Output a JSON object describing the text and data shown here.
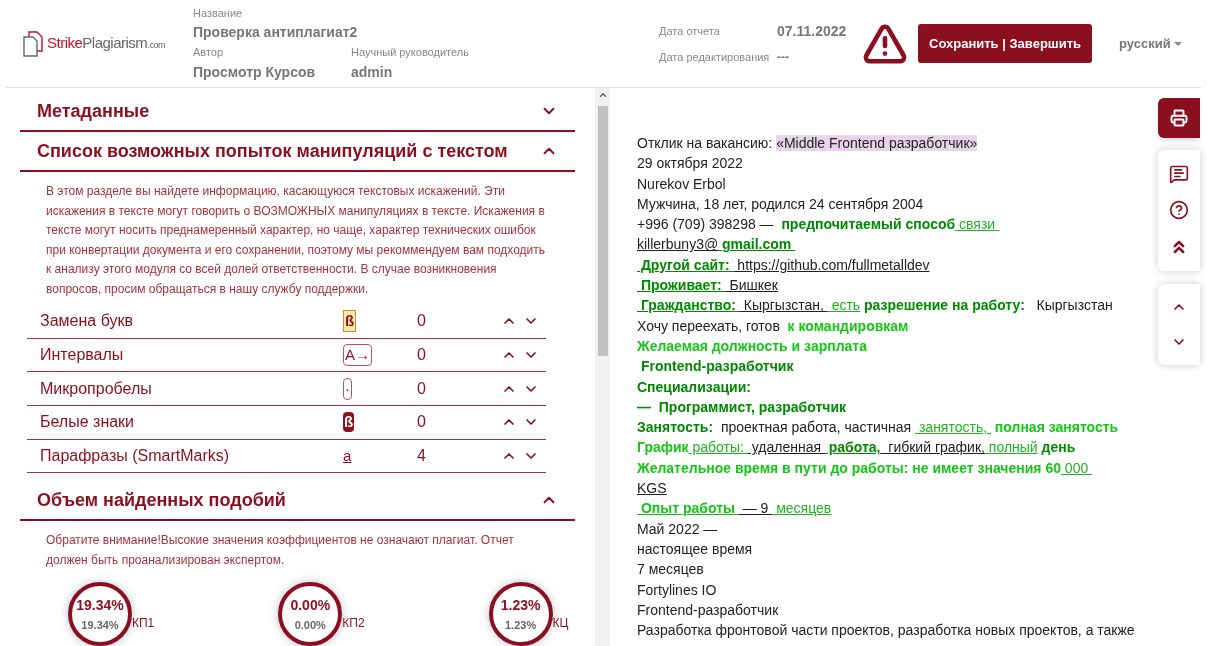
{
  "header": {
    "logo": {
      "part_1": "Strike",
      "part_2": "Plagiarism",
      "part_3": ".com"
    },
    "fields": [
      {
        "label": "Название",
        "value": "Проверка антиплагиат2"
      },
      {
        "label": "Автор",
        "value": "Просмотр Курсов"
      },
      {
        "label": "Научный руководитель",
        "value": "admin"
      }
    ],
    "dates": [
      {
        "label": "Дата отчета",
        "value": "07.11.2022"
      },
      {
        "label": "Дата редактирования",
        "value": "---"
      }
    ],
    "save_button": "Сохранить | Завершить",
    "language": "русский"
  },
  "sections": [
    {
      "title": "Метаданные",
      "expanded": false
    },
    {
      "title": "Список возможных попыток манипуляций с текстом",
      "expanded": true,
      "description": "В этом разделе вы найдете информацию, касающуюся текстовых искажений. Эти искажения в тексте могут говорить о ВОЗМОЖНЫХ манипуляциях в тексте. Искажения в тексте могут носить преднамеренный характер, но чаще, характер технических ошибок при конвертации документа и его сохранении, поэтому мы рекоммендуем вам подходить к анализу этого модуля со всей долей ответственности. В случае возникновения вопросов, просим обращаться в нашу службу поддержки.",
      "rows": [
        {
          "label": "Замена букв",
          "marker": "ß",
          "kind": "highlight",
          "count": "0"
        },
        {
          "label": "Интервалы",
          "marker": "A→",
          "kind": "boxed",
          "count": "0"
        },
        {
          "label": "Микропробелы",
          "marker": "·",
          "kind": "boxed",
          "count": "0"
        },
        {
          "label": "Белые знаки",
          "marker": "ß",
          "kind": "inverted",
          "count": "0"
        },
        {
          "label": "Парафразы (SmartMarks)",
          "marker": "a",
          "kind": "underlined",
          "count": "4"
        }
      ]
    },
    {
      "title": "Объем найденных подобий",
      "expanded": true,
      "description": "Обратите внимание!Высокие значения коэффициентов не означают плагиат. Отчет должен быть проанализирован экспертом.",
      "gauges": [
        {
          "value": "19.34%",
          "subvalue": "19.34%",
          "label": "КП1"
        },
        {
          "value": "0.00%",
          "subvalue": "0.00%",
          "label": "КП2"
        },
        {
          "value": "1.23%",
          "subvalue": "1.23%",
          "label": "КЦ"
        }
      ]
    }
  ],
  "document": {
    "lines": [
      [
        {
          "text": "Отклик на вакансию: ",
          "kind": "plain",
          "underlined": false
        },
        {
          "text": "«Middle Frontend разработчик»",
          "kind": "highlight",
          "underlined": false
        }
      ],
      [
        {
          "text": "29 октября 2022",
          "kind": "plain",
          "underlined": false
        }
      ],
      [
        {
          "text": "Nurekov Erbol",
          "kind": "plain",
          "underlined": false
        }
      ],
      [
        {
          "text": "Мужчина, 18 лет, родился 24 сентября 2004",
          "kind": "plain",
          "underlined": false
        }
      ],
      [
        {
          "text": "+996 (709) 398298 — ",
          "kind": "plain",
          "underlined": false
        },
        {
          "text": " предпочитаемый способ",
          "kind": "strong",
          "underlined": false
        },
        {
          "text": " связи ",
          "kind": "link",
          "underlined": true
        }
      ],
      [
        {
          "text": "killerbuny3@",
          "kind": "plain",
          "underlined": true
        },
        {
          "text": " gmail.com ",
          "kind": "strong",
          "underlined": true
        }
      ],
      [
        {
          "text": " Другой сайт: ",
          "kind": "strong",
          "underlined": true
        },
        {
          "text": " https://github.com/fullmetalldev",
          "kind": "plain",
          "underlined": true
        }
      ],
      [
        {
          "text": " Проживает: ",
          "kind": "strong",
          "underlined": true
        },
        {
          "text": " Бишкек",
          "kind": "plain",
          "underlined": true
        }
      ],
      [
        {
          "text": " Гражданство: ",
          "kind": "strong",
          "underlined": true
        },
        {
          "text": " Кыргызстан, ",
          "kind": "plain",
          "underlined": true
        },
        {
          "text": " есть",
          "kind": "link",
          "underlined": true
        },
        {
          "text": " разрешение на работу: ",
          "kind": "strong",
          "underlined": false
        },
        {
          "text": "  Кыргызстан",
          "kind": "plain",
          "underlined": false
        }
      ],
      [
        {
          "text": "Хочу переехать, готов ",
          "kind": "plain",
          "underlined": false
        },
        {
          "text": " к командировкам",
          "kind": "bright",
          "underlined": false
        }
      ],
      [
        {
          "text": "Желаемая должность и зарплата",
          "kind": "bright",
          "underlined": false
        }
      ],
      [
        {
          "text": " Frontend-разработчик",
          "kind": "strong",
          "underlined": false
        }
      ],
      [
        {
          "text": "Специализации:",
          "kind": "strong",
          "underlined": false
        }
      ],
      [
        {
          "text": "—  Программист, разработчик",
          "kind": "strong",
          "underlined": false
        }
      ],
      [
        {
          "text": "Занятость:",
          "kind": "strong",
          "underlined": false
        },
        {
          "text": "  проектная работа, частичная ",
          "kind": "plain",
          "underlined": false
        },
        {
          "text": " занятость, ",
          "kind": "link",
          "underlined": true
        },
        {
          "text": " полная занятость",
          "kind": "bright",
          "underlined": false
        }
      ],
      [
        {
          "text": "График",
          "kind": "bright",
          "underlined": false
        },
        {
          "text": " работы: ",
          "kind": "link",
          "underlined": true
        },
        {
          "text": " удаленная ",
          "kind": "plain",
          "underlined": true
        },
        {
          "text": " работа,",
          "kind": "strong",
          "underlined": true
        },
        {
          "text": "  гибкий график,",
          "kind": "plain",
          "underlined": true
        },
        {
          "text": " полный",
          "kind": "link",
          "underlined": true
        },
        {
          "text": " день",
          "kind": "strong",
          "underlined": false
        }
      ],
      [
        {
          "text": "Желательное время в пути до работы: не имеет значения 60",
          "kind": "bright",
          "underlined": false
        },
        {
          "text": " 000 ",
          "kind": "link",
          "underlined": true
        }
      ],
      [
        {
          "text": "KGS",
          "kind": "plain",
          "underlined": true
        }
      ],
      [
        {
          "text": " Опыт работы ",
          "kind": "bright",
          "underlined": true
        },
        {
          "text": " — 9 ",
          "kind": "plain",
          "underlined": true
        },
        {
          "text": " месяцев",
          "kind": "link",
          "underlined": true
        }
      ],
      [
        {
          "text": "Май 2022 —",
          "kind": "plain",
          "underlined": false
        }
      ],
      [
        {
          "text": "настоящее время",
          "kind": "plain",
          "underlined": false
        }
      ],
      [
        {
          "text": "7 месяцев",
          "kind": "plain",
          "underlined": false
        }
      ],
      [
        {
          "text": "Fortylines IO",
          "kind": "plain",
          "underlined": false
        }
      ],
      [
        {
          "text": "Frontend-разработчик",
          "kind": "plain",
          "underlined": false
        }
      ],
      [
        {
          "text": "Разработка фронтовой части проектов, разработка новых проектов, а также",
          "kind": "plain",
          "underlined": false
        }
      ]
    ]
  }
}
